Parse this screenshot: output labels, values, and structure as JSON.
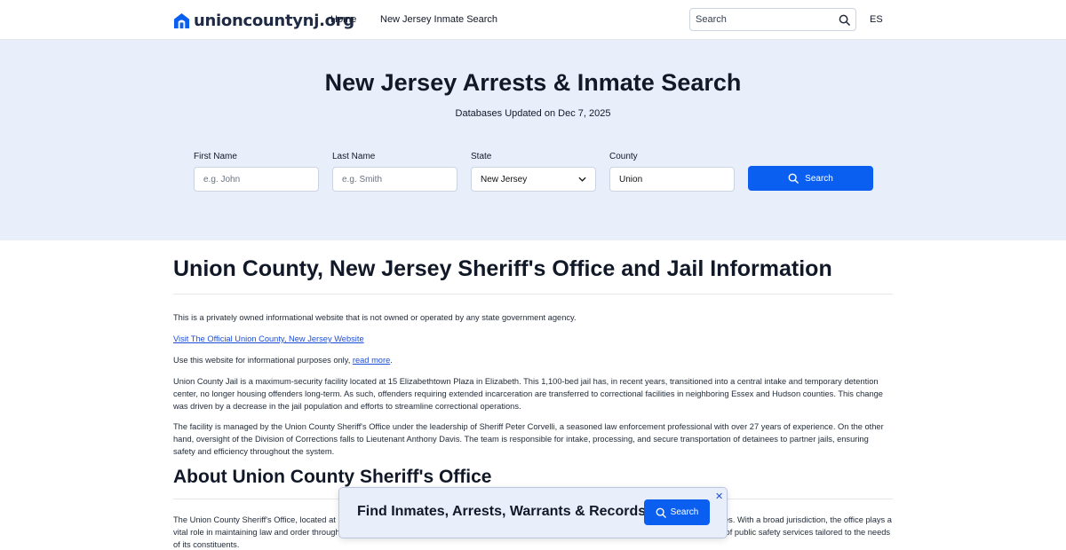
{
  "header": {
    "logo_text": "unioncountynj.org",
    "nav": [
      "Home",
      "New Jersey Inmate Search"
    ],
    "search_placeholder": "Search",
    "language": "ES"
  },
  "hero": {
    "title": "New Jersey Arrests & Inmate Search",
    "updated": "Databases Updated on Dec 7, 2025",
    "fields": {
      "first_name": {
        "label": "First Name",
        "placeholder": "e.g. John"
      },
      "last_name": {
        "label": "Last Name",
        "placeholder": "e.g. Smith"
      },
      "state": {
        "label": "State",
        "value": "New Jersey"
      },
      "county": {
        "label": "County",
        "value": "Union"
      }
    },
    "search_button": "Search"
  },
  "content": {
    "heading": "Union County, New Jersey Sheriff's Office and Jail Information",
    "disclaimer": "This is a privately owned informational website that is not owned or operated by any state government agency.",
    "official_link": "Visit The Official Union County, New Jersey Website",
    "use_text": "Use this website for informational purposes only, ",
    "read_more": "read more",
    "use_end": ".",
    "jail_paragraph": "Union County Jail is a maximum-security facility located at 15 Elizabethtown Plaza in Elizabeth. This 1,100-bed jail has, in recent years, transitioned into a central intake and temporary detention center, no longer housing offenders long-term. As such, offenders requiring extended incarceration are transferred to correctional facilities in neighboring Essex and Hudson counties. This change was driven by a decrease in the jail population and efforts to streamline correctional operations.",
    "management_paragraph": "The facility is managed by the Union County Sheriff's Office under the leadership of Sheriff Peter Corvelli, a seasoned law enforcement professional with over 27 years of experience. On the other hand, oversight of the Division of Corrections falls to Lieutenant Anthony Davis. The team is responsible for intake, processing, and secure transportation of detainees to partner jails, ensuring safety and efficiency throughout the system.",
    "about_heading": "About Union County Sheriff's Office",
    "about_paragraph": "The Union County Sheriff's Office, located at 10 Elizabethtown Plaza in Elizabeth, is a law enforcement agency serving residents across 21 municipalities. With a broad jurisdiction, the office plays a vital role in maintaining law and order throughout the region. Its operations extend across both urban and suburban communities, offering a wide range of public safety services tailored to the needs of its constituents."
  },
  "popup": {
    "title": "Find Inmates, Arrests, Warrants & Records",
    "button": "Search",
    "close": "✕"
  },
  "colors": {
    "accent": "#0b5ff0",
    "hero_bg": "#e8effb",
    "link": "#1d4ed8"
  }
}
